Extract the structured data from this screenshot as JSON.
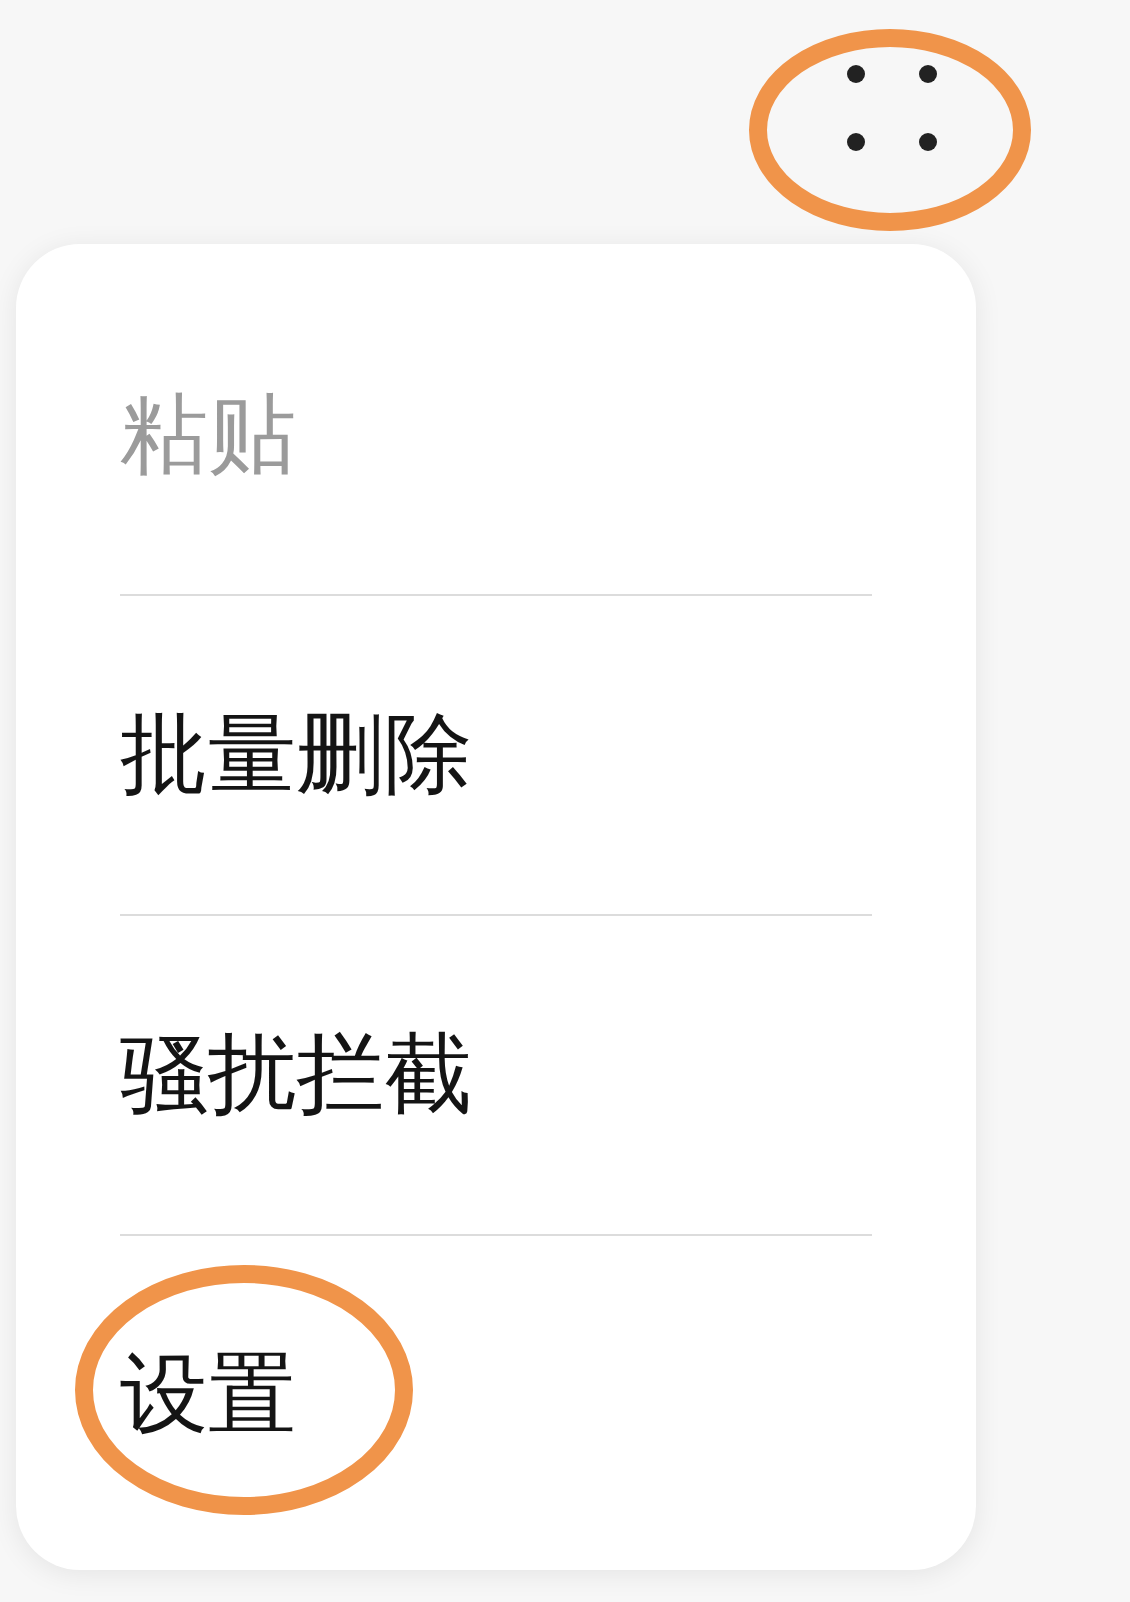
{
  "menu_items": [
    {
      "label": "粘贴",
      "disabled": true
    },
    {
      "label": "批量删除",
      "disabled": false
    },
    {
      "label": "骚扰拦截",
      "disabled": false
    },
    {
      "label": "设置",
      "disabled": false
    }
  ]
}
